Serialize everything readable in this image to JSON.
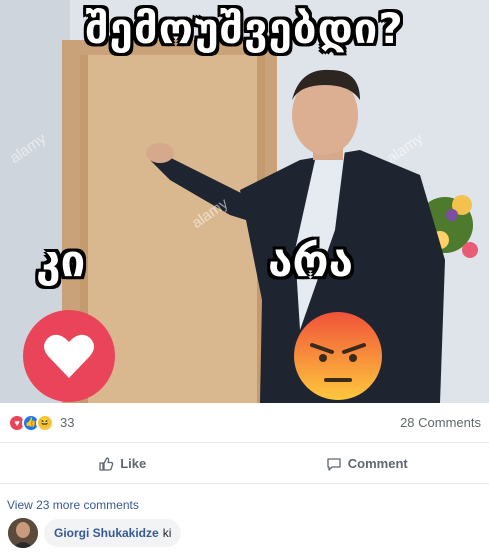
{
  "post": {
    "title_text": "შემოუშვებდი?",
    "option_yes": "კი",
    "option_no": "არა",
    "watermark": "alamy"
  },
  "reactions": {
    "count": "33",
    "comments": "28 Comments",
    "icons": [
      "love-icon",
      "like-icon",
      "haha-icon"
    ]
  },
  "actions": {
    "like_label": "Like",
    "comment_label": "Comment"
  },
  "comments_section": {
    "view_more": "View 23 more comments",
    "comment": {
      "author": "Giorgi Shukakidze",
      "text": "ki"
    }
  },
  "colors": {
    "love": "#e9445a",
    "like": "#1877f2",
    "angry_top": "#f0533a",
    "angry_bottom": "#ffc83d",
    "link": "#385898"
  }
}
